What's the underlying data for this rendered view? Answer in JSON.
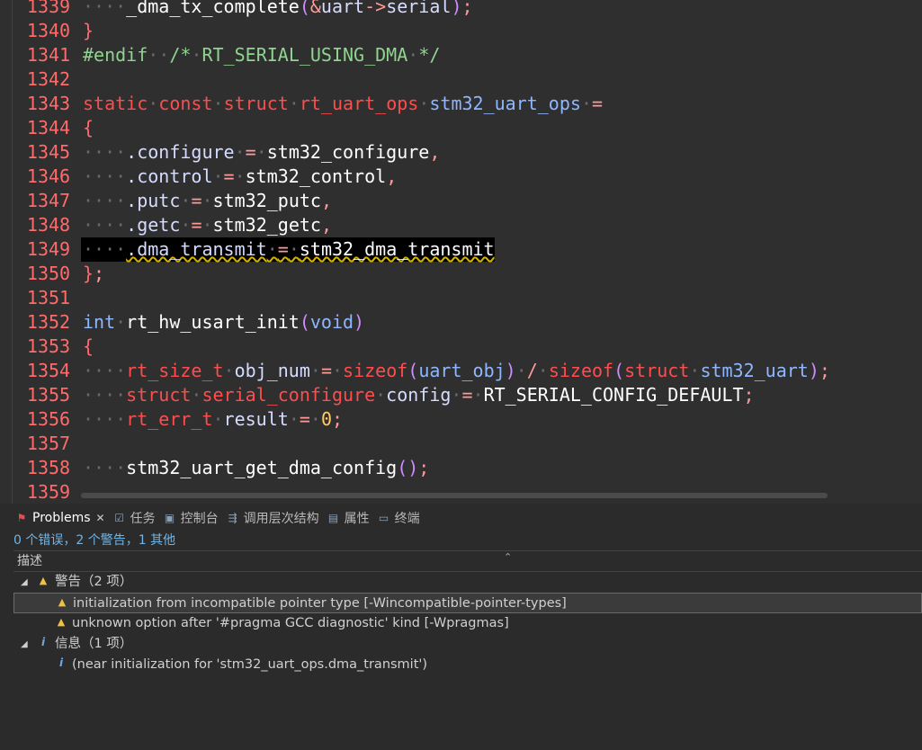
{
  "editor": {
    "lines": [
      {
        "n": "1339",
        "code": [
          [
            "dt",
            "····"
          ],
          [
            "fn",
            "_dma_tx_complete"
          ],
          [
            "paren",
            "("
          ],
          [
            "op",
            "&"
          ],
          [
            "mem",
            "uart"
          ],
          [
            "op",
            "->"
          ],
          [
            "mem",
            "serial"
          ],
          [
            "paren",
            ")"
          ],
          [
            "op",
            ";"
          ]
        ]
      },
      {
        "n": "1340",
        "code": [
          [
            "brace",
            "}"
          ]
        ]
      },
      {
        "n": "1341",
        "code": [
          [
            "pp",
            "#endif"
          ],
          [
            "dt",
            "··"
          ],
          [
            "cm",
            "/*"
          ],
          [
            "dt",
            "·"
          ],
          [
            "cm",
            "RT_SERIAL_USING_DMA"
          ],
          [
            "dt",
            "·"
          ],
          [
            "cm",
            "*/"
          ]
        ]
      },
      {
        "n": "1342",
        "code": []
      },
      {
        "n": "1343",
        "code": [
          [
            "kw",
            "static"
          ],
          [
            "dt",
            "·"
          ],
          [
            "kw",
            "const"
          ],
          [
            "dt",
            "·"
          ],
          [
            "kw",
            "struct"
          ],
          [
            "dt",
            "·"
          ],
          [
            "kw",
            "rt_uart_ops"
          ],
          [
            "dt",
            "·"
          ],
          [
            "ty",
            "stm32_uart_ops"
          ],
          [
            "dt",
            "·"
          ],
          [
            "op",
            "="
          ]
        ]
      },
      {
        "n": "1344",
        "code": [
          [
            "brace",
            "{"
          ]
        ]
      },
      {
        "n": "1345",
        "code": [
          [
            "dt",
            "····"
          ],
          [
            "mem",
            ".configure"
          ],
          [
            "dt",
            "·"
          ],
          [
            "op",
            "="
          ],
          [
            "dt",
            "·"
          ],
          [
            "fn",
            "stm32_configure"
          ],
          [
            "op",
            ","
          ]
        ]
      },
      {
        "n": "1346",
        "code": [
          [
            "dt",
            "····"
          ],
          [
            "mem",
            ".control"
          ],
          [
            "dt",
            "·"
          ],
          [
            "op",
            "="
          ],
          [
            "dt",
            "·"
          ],
          [
            "fn",
            "stm32_control"
          ],
          [
            "op",
            ","
          ]
        ]
      },
      {
        "n": "1347",
        "code": [
          [
            "dt",
            "····"
          ],
          [
            "mem",
            ".putc"
          ],
          [
            "dt",
            "·"
          ],
          [
            "op",
            "="
          ],
          [
            "dt",
            "·"
          ],
          [
            "fn",
            "stm32_putc"
          ],
          [
            "op",
            ","
          ]
        ]
      },
      {
        "n": "1348",
        "code": [
          [
            "dt",
            "····"
          ],
          [
            "mem",
            ".getc"
          ],
          [
            "dt",
            "·"
          ],
          [
            "op",
            "="
          ],
          [
            "dt",
            "·"
          ],
          [
            "fn",
            "stm32_getc"
          ],
          [
            "op",
            ","
          ]
        ]
      },
      {
        "n": "1349",
        "code": [
          [
            "dt",
            "····"
          ],
          [
            "sq-mem",
            ".dma_transmit"
          ],
          [
            "sq-dt",
            "·"
          ],
          [
            "sq-op",
            "="
          ],
          [
            "sq-dt",
            "·"
          ],
          [
            "sq-fn",
            "stm32_dma_transmit"
          ]
        ],
        "current": true
      },
      {
        "n": "1350",
        "code": [
          [
            "brace",
            "}"
          ],
          [
            "op",
            ";"
          ]
        ]
      },
      {
        "n": "1351",
        "code": []
      },
      {
        "n": "1352",
        "code": [
          [
            "ty",
            "int"
          ],
          [
            "dt",
            "·"
          ],
          [
            "fn",
            "rt_hw_usart_init"
          ],
          [
            "paren",
            "("
          ],
          [
            "ty",
            "void"
          ],
          [
            "paren",
            ")"
          ]
        ]
      },
      {
        "n": "1353",
        "code": [
          [
            "brace",
            "{"
          ]
        ]
      },
      {
        "n": "1354",
        "code": [
          [
            "dt",
            "····"
          ],
          [
            "kw",
            "rt_size_t"
          ],
          [
            "dt",
            "·"
          ],
          [
            "mem",
            "obj_num"
          ],
          [
            "dt",
            "·"
          ],
          [
            "op",
            "="
          ],
          [
            "dt",
            "·"
          ],
          [
            "kw",
            "sizeof"
          ],
          [
            "paren",
            "("
          ],
          [
            "ty",
            "uart_obj"
          ],
          [
            "paren",
            ")"
          ],
          [
            "dt",
            "·"
          ],
          [
            "op",
            "/"
          ],
          [
            "dt",
            "·"
          ],
          [
            "kw",
            "sizeof"
          ],
          [
            "paren",
            "("
          ],
          [
            "kw",
            "struct"
          ],
          [
            "dt",
            "·"
          ],
          [
            "ty",
            "stm32_uart"
          ],
          [
            "paren",
            ")"
          ],
          [
            "op",
            ";"
          ]
        ]
      },
      {
        "n": "1355",
        "code": [
          [
            "dt",
            "····"
          ],
          [
            "kw",
            "struct"
          ],
          [
            "dt",
            "·"
          ],
          [
            "kw",
            "serial_configure"
          ],
          [
            "dt",
            "·"
          ],
          [
            "mem",
            "config"
          ],
          [
            "dt",
            "·"
          ],
          [
            "op",
            "="
          ],
          [
            "dt",
            "·"
          ],
          [
            "fn",
            "RT_SERIAL_CONFIG_DEFAULT"
          ],
          [
            "op",
            ";"
          ]
        ]
      },
      {
        "n": "1356",
        "code": [
          [
            "dt",
            "····"
          ],
          [
            "kw",
            "rt_err_t"
          ],
          [
            "dt",
            "·"
          ],
          [
            "mem",
            "result"
          ],
          [
            "dt",
            "·"
          ],
          [
            "op",
            "="
          ],
          [
            "dt",
            "·"
          ],
          [
            "num",
            "0"
          ],
          [
            "op",
            ";"
          ]
        ]
      },
      {
        "n": "1357",
        "code": []
      },
      {
        "n": "1358",
        "code": [
          [
            "dt",
            "····"
          ],
          [
            "fn",
            "stm32_uart_get_dma_config"
          ],
          [
            "paren",
            "()"
          ],
          [
            "op",
            ";"
          ]
        ]
      },
      {
        "n": "1359",
        "code": []
      }
    ]
  },
  "panel": {
    "tabs": [
      {
        "label": "Problems",
        "icon": "problems-icon",
        "glyph": "⚑",
        "active": true
      },
      {
        "label": "任务",
        "icon": "tasks-icon",
        "glyph": "☑"
      },
      {
        "label": "控制台",
        "icon": "console-icon",
        "glyph": "▣"
      },
      {
        "label": "调用层次结构",
        "icon": "call-hierarchy-icon",
        "glyph": "⇶"
      },
      {
        "label": "属性",
        "icon": "properties-icon",
        "glyph": "▤"
      },
      {
        "label": "终端",
        "icon": "terminal-icon",
        "glyph": "▭"
      }
    ],
    "summary": "0 个错误，2 个警告，1 其他",
    "column_header": "描述",
    "warnings_group": "警告（2 项）",
    "warning_1": "initialization from incompatible pointer type [-Wincompatible-pointer-types]",
    "warning_2": "unknown option after '#pragma GCC diagnostic' kind [-Wpragmas]",
    "info_group": "信息（1 项）",
    "info_1": "(near initialization for 'stm32_uart_ops.dma_transmit')"
  }
}
